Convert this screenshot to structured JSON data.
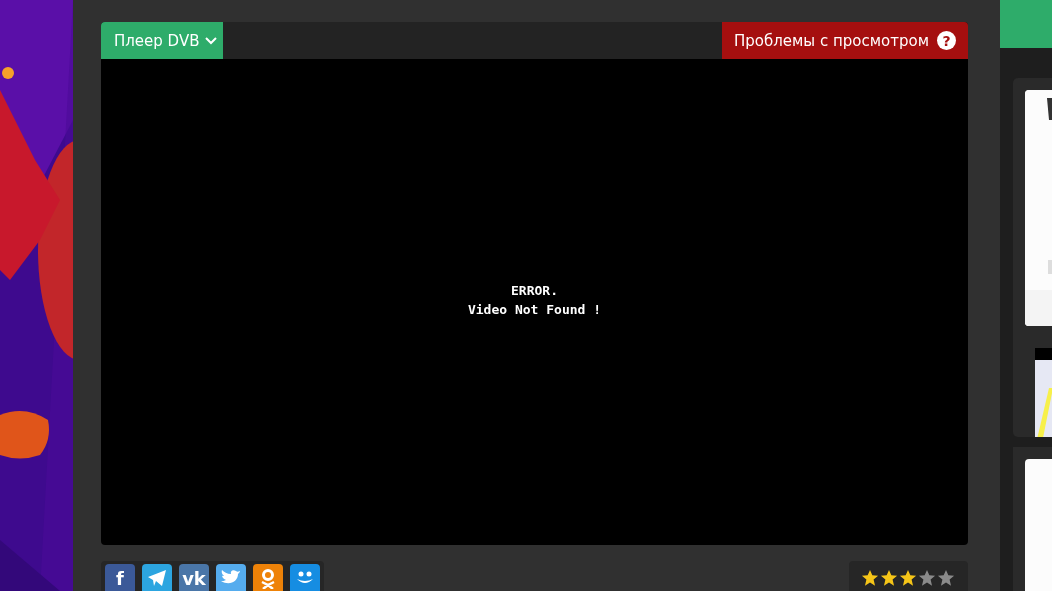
{
  "player": {
    "source_menu": {
      "label": "Плеер DVB"
    },
    "problem_button": {
      "label": "Проблемы с просмотром",
      "icon": "?"
    },
    "message": [
      "ERROR.",
      "Video Not Found !"
    ]
  },
  "share": [
    {
      "kind": "facebook",
      "color": "#3b5998",
      "glyph": "f"
    },
    {
      "kind": "telegram",
      "color": "#2ca5e0"
    },
    {
      "kind": "vk",
      "color": "#4a76a8",
      "glyph": "vk"
    },
    {
      "kind": "twitter",
      "color": "#55acee"
    },
    {
      "kind": "ok",
      "color": "#ee8208"
    },
    {
      "kind": "mymir",
      "color": "#168de2"
    }
  ],
  "rating": {
    "stars": 3
  }
}
